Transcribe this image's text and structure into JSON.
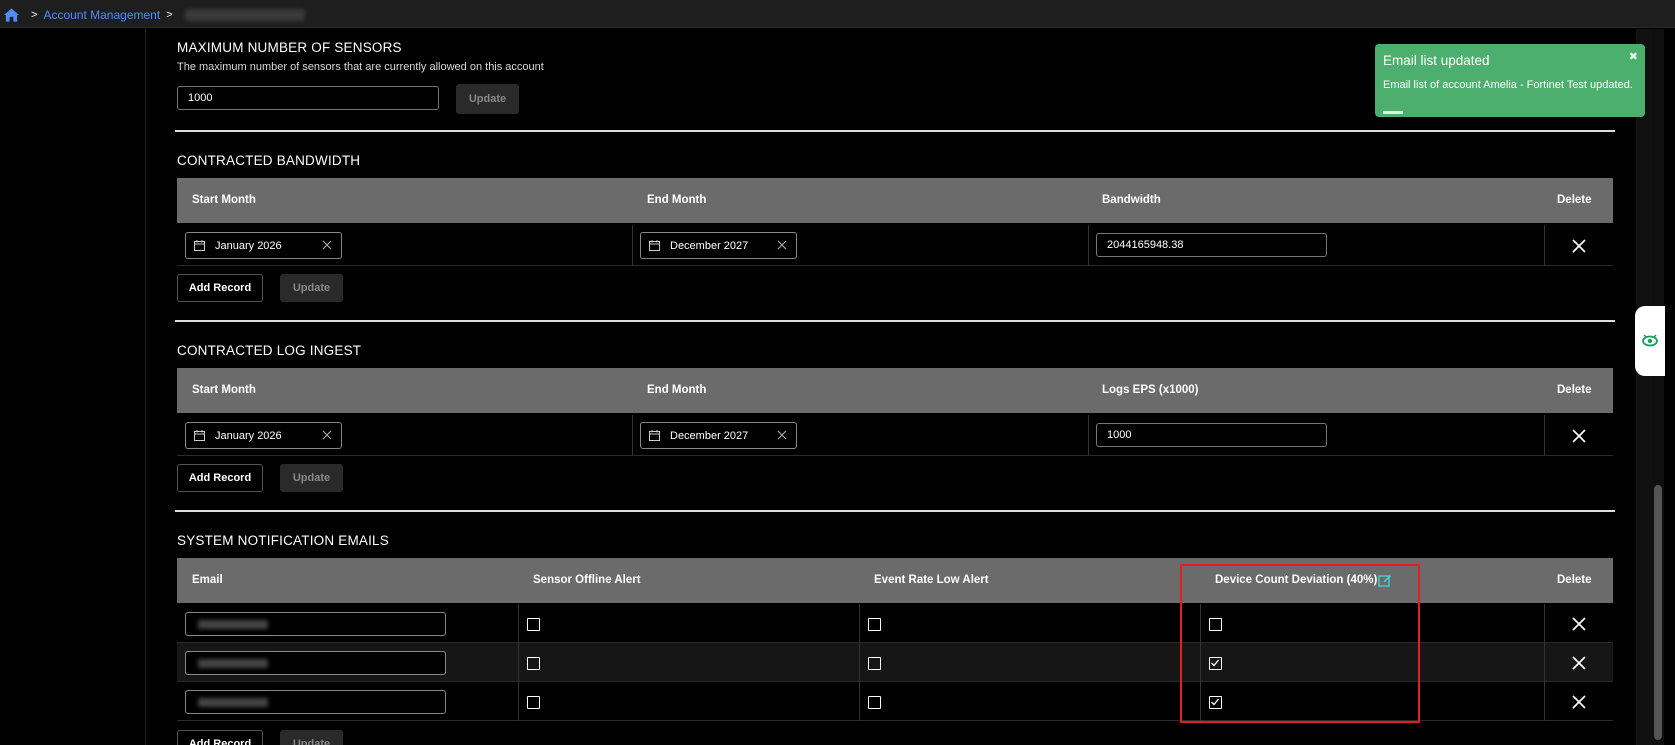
{
  "breadcrumb": {
    "account_management": "Account Management",
    "separator": ">"
  },
  "max_sensors": {
    "title": "MAXIMUM NUMBER OF SENSORS",
    "description": "The maximum number of sensors that are currently allowed on this account",
    "value": "1000",
    "update_label": "Update"
  },
  "bandwidth": {
    "title": "CONTRACTED BANDWIDTH",
    "headers": [
      "Start Month",
      "End Month",
      "Bandwidth",
      "Delete"
    ],
    "rows": [
      {
        "start": "January 2026",
        "end": "December 2027",
        "value": "2044165948.38"
      }
    ],
    "add_label": "Add Record",
    "update_label": "Update"
  },
  "log_ingest": {
    "title": "CONTRACTED LOG INGEST",
    "headers": [
      "Start Month",
      "End Month",
      "Logs EPS (x1000)",
      "Delete"
    ],
    "rows": [
      {
        "start": "January 2026",
        "end": "December 2027",
        "value": "1000"
      }
    ],
    "add_label": "Add Record",
    "update_label": "Update"
  },
  "notifications": {
    "title": "SYSTEM NOTIFICATION EMAILS",
    "headers": [
      "Email",
      "Sensor Offline Alert",
      "Event Rate Low Alert",
      "Device Count Deviation (40%)",
      "Delete"
    ],
    "rows": [
      {
        "sensor_offline": false,
        "event_rate_low": false,
        "device_count": false
      },
      {
        "sensor_offline": false,
        "event_rate_low": false,
        "device_count": true
      },
      {
        "sensor_offline": false,
        "event_rate_low": false,
        "device_count": true
      }
    ],
    "add_label": "Add Record",
    "update_label": "Update"
  },
  "toast": {
    "title": "Email list updated",
    "body": "Email list of account Amelia - Fortinet Test updated.",
    "close": "✖",
    "color": "#4caf6e"
  },
  "colors": {
    "link": "#4d8dff",
    "header_bg": "#6b6b6b",
    "highlight": "#e02020",
    "edit_icon": "#3ddcdc"
  }
}
